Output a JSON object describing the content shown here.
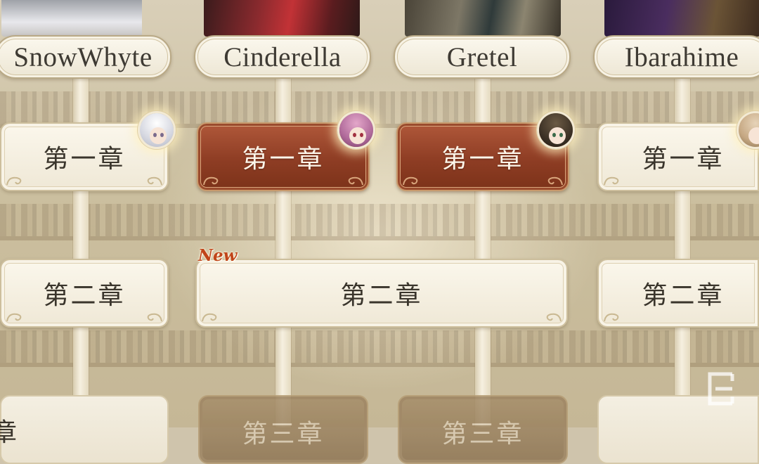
{
  "characters": [
    {
      "name": "SnowWhyte"
    },
    {
      "name": "Cinderella"
    },
    {
      "name": "Gretel"
    },
    {
      "name": "Ibarahime"
    }
  ],
  "chapters": {
    "ch1": "第一章",
    "ch2": "第二章",
    "ch3_partial": "章",
    "ch3": "第三章"
  },
  "badges": {
    "new": "New"
  },
  "colors": {
    "active_chapter": "#8e3d24",
    "inactive_chapter": "#f3eddd",
    "new_badge": "#c0451a",
    "nameplate_text": "#3e3a33"
  },
  "icons": [
    "snowwhyte-avatar",
    "cinderella-avatar",
    "gretel-avatar",
    "ibarahime-avatar",
    "logo-watermark"
  ]
}
